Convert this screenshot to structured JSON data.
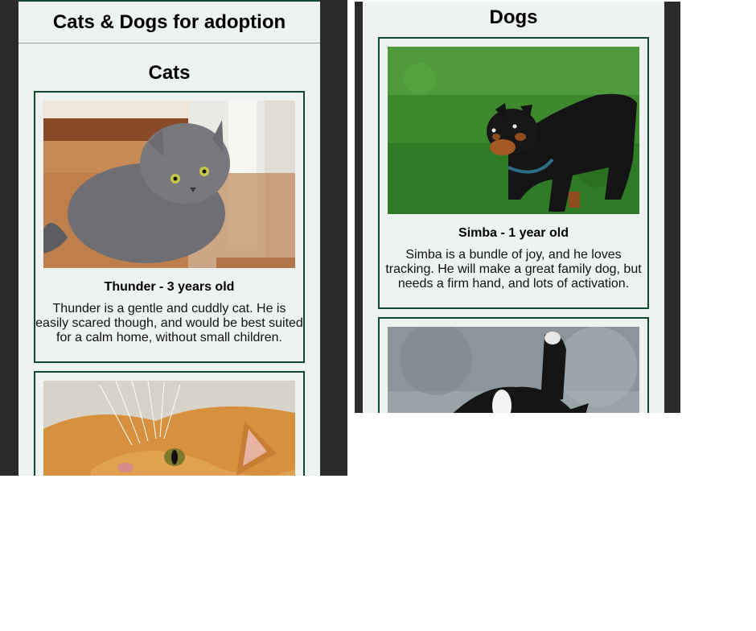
{
  "site": {
    "title": "Cats & Dogs for adoption"
  },
  "cats": {
    "heading": "Cats",
    "items": [
      {
        "name": "Thunder - 3 years old",
        "description": "Thunder is a gentle and cuddly cat. He is easily scared though, and would be best suited for a calm home, without small children."
      },
      {
        "name": "",
        "description": ""
      }
    ]
  },
  "dogs": {
    "heading": "Dogs",
    "items": [
      {
        "name": "Simba - 1 year old",
        "description": "Simba is a bundle of joy, and he loves tracking. He will make a great family dog, but needs a firm hand, and lots of activation."
      },
      {
        "name": "",
        "description": ""
      }
    ]
  },
  "colors": {
    "frame": "#2b2b2b",
    "page_bg": "#eef3f2",
    "card_border": "#0f4a2e"
  }
}
